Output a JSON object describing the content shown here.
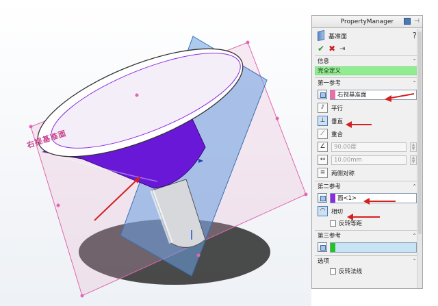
{
  "viewport": {
    "plane_label": "右视基准面"
  },
  "property_manager": {
    "title": "PropertyManager",
    "feature_name": "基准面",
    "help_icon": "?",
    "actions": {
      "ok": "✔",
      "cancel": "✖",
      "pin": "⇥"
    },
    "info": {
      "header": "信息",
      "status": "完全定义"
    },
    "first_reference": {
      "header": "第一参考",
      "selection": "右视基准面",
      "selection_color": "#f06aa8",
      "options": {
        "parallel": "平行",
        "perpendicular": "垂直",
        "coincident": "重合"
      },
      "angle_value": "90.00度",
      "distance_value": "10.00mm",
      "mid_plane": "两侧对称"
    },
    "second_reference": {
      "header": "第二参考",
      "selection": "面<1>",
      "selection_color": "#8a2be2",
      "tangent": "相切",
      "flip_distance": "反转等距"
    },
    "third_reference": {
      "header": "第三参考",
      "selection_color": "#22c322"
    },
    "options": {
      "header": "选项",
      "flip_normal": "反转法线"
    }
  }
}
